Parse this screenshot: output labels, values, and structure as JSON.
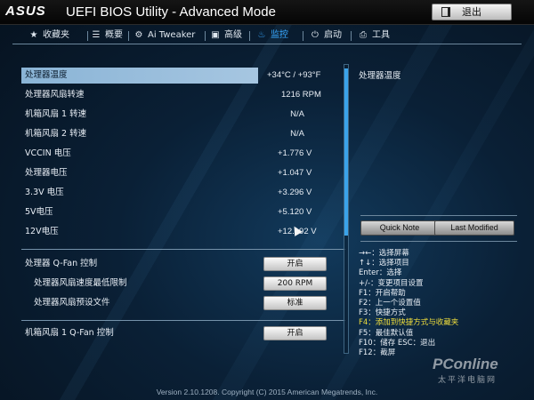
{
  "header": {
    "logo": "ASUS",
    "title": "UEFI BIOS Utility - Advanced Mode",
    "exit_label": "退出"
  },
  "nav": {
    "tabs": [
      {
        "label": "收藏夹",
        "icon": "star-icon"
      },
      {
        "label": "概要",
        "icon": "list-icon"
      },
      {
        "label": "Ai Tweaker",
        "icon": "tweaker-icon"
      },
      {
        "label": "高级",
        "icon": "advanced-icon"
      },
      {
        "label": "监控",
        "icon": "monitor-icon",
        "active": true
      },
      {
        "label": "启动",
        "icon": "power-icon"
      },
      {
        "label": "工具",
        "icon": "printer-icon"
      }
    ]
  },
  "monitor": {
    "rows": [
      {
        "label": "处理器温度",
        "value": "+34°C / +93°F",
        "selected": true
      },
      {
        "label": "处理器风扇转速",
        "value": "1216 RPM"
      },
      {
        "label": "机箱风扇 1 转速",
        "value": "N/A"
      },
      {
        "label": "机箱风扇 2 转速",
        "value": "N/A"
      },
      {
        "label": "VCCIN 电压",
        "value": "+1.776 V"
      },
      {
        "label": "处理器电压",
        "value": "+1.047 V"
      },
      {
        "label": "3.3V 电压",
        "value": "+3.296 V"
      },
      {
        "label": "5V电压",
        "value": "+5.120 V"
      },
      {
        "label": "12V电压",
        "value": "+12.192 V"
      }
    ],
    "qfan": [
      {
        "label": "处理器 Q-Fan 控制",
        "button": "开启"
      },
      {
        "label": "处理器风扇速度最低限制",
        "button": "200 RPM"
      },
      {
        "label": "处理器风扇预设文件",
        "button": "标准"
      }
    ],
    "chassis_qfan": {
      "label": "机箱风扇 1 Q-Fan 控制",
      "button": "开启"
    }
  },
  "help": {
    "title": "处理器温度",
    "quick_note": "Quick Note",
    "last_modified": "Last Modified",
    "keys": [
      "→←：选择屏幕",
      "↑↓：选择项目",
      "Enter：选择",
      "+/-：变更项目设置",
      "F1：开启帮助",
      "F2：上一个设置值",
      "F3：快捷方式",
      "F4：添加到快捷方式与收藏夹",
      "F5：最佳默认值",
      "F10：储存  ESC：退出",
      "F12：截屏"
    ]
  },
  "footer": {
    "version": "Version 2.10.1208. Copyright (C) 2015 American Megatrends, Inc."
  },
  "watermark": {
    "logo": "PConline",
    "sub": "太平洋电脑网"
  }
}
